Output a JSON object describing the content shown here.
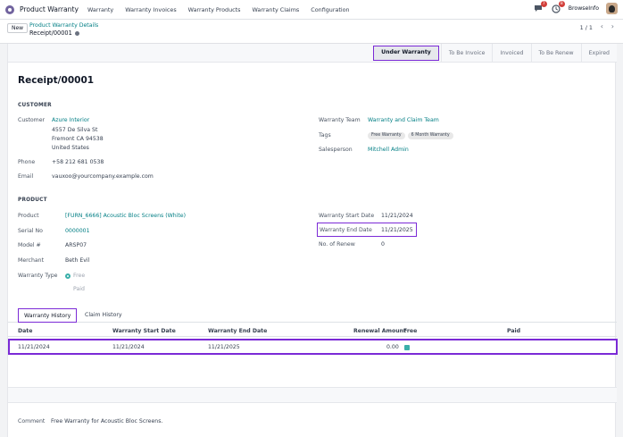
{
  "nav": {
    "app_name": "Product Warranty",
    "menu": [
      "Warranty",
      "Warranty Invoices",
      "Warranty Products",
      "Warranty Claims",
      "Configuration"
    ],
    "chat_badge": "7",
    "activity_badge": "8",
    "user_name": "BrowseInfo"
  },
  "control_panel": {
    "new_label": "New",
    "breadcrumb_parent": "Product Warranty Details",
    "breadcrumb_current": "Receipt/00001",
    "pager": "1 / 1"
  },
  "statusbar": {
    "stages": [
      "Under Warranty",
      "To Be Invoice",
      "Invoiced",
      "To Be Renew",
      "Expired"
    ],
    "active": "Under Warranty"
  },
  "record": {
    "title": "Receipt/00001",
    "customer_section": "CUSTOMER",
    "customer_label": "Customer",
    "customer_name": "Azure Interior",
    "address_1": "4557 De Silva St",
    "address_2": "Fremont CA 94538",
    "address_3": "United States",
    "phone_label": "Phone",
    "phone": "+58 212 681 0538",
    "email_label": "Email",
    "email": "vauxoo@yourcompany.example.com",
    "warranty_team_label": "Warranty Team",
    "warranty_team": "Warranty and Claim Team",
    "tags_label": "Tags",
    "tags": [
      "Free Warranty",
      "6 Month Warranty"
    ],
    "salesperson_label": "Salesperson",
    "salesperson": "Mitchell Admin",
    "product_section": "PRODUCT",
    "product_label": "Product",
    "product": "[FURN_6666] Acoustic Bloc Screens (White)",
    "serial_label": "Serial No",
    "serial": "0000001",
    "model_label": "Model #",
    "model": "ARSP07",
    "merchant_label": "Merchant",
    "merchant": "Beth Evil",
    "warranty_type_label": "Warranty Type",
    "warranty_type_options": [
      "Free",
      "Paid"
    ],
    "start_date_label": "Warranty Start Date",
    "start_date": "11/21/2024",
    "end_date_label": "Warranty End Date",
    "end_date": "11/21/2025",
    "renew_label": "No. of Renew",
    "renew": "0",
    "comment_label": "Comment",
    "comment": "Free Warranty for Acoustic Bloc Screens."
  },
  "tabs": [
    "Warranty History",
    "Claim History"
  ],
  "history_table": {
    "headers": [
      "Date",
      "Warranty Start Date",
      "Warranty End Date",
      "Renewal Amount",
      "Free",
      "Paid"
    ],
    "rows": [
      {
        "date": "11/21/2024",
        "start": "11/21/2024",
        "end": "11/21/2025",
        "amount": "0.00",
        "free": true,
        "paid": ""
      }
    ]
  },
  "colors": {
    "accent": "#017e84",
    "highlight": "#7b2ad6",
    "brand": "#71639e"
  }
}
